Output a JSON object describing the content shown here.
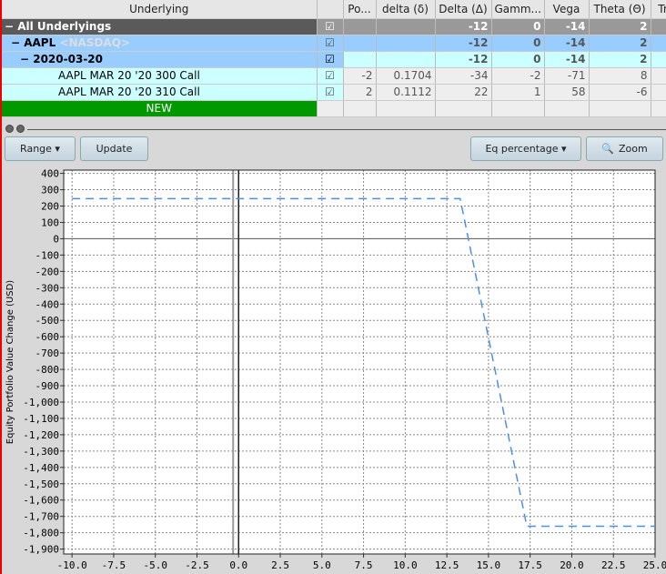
{
  "table": {
    "columns": [
      "Underlying",
      "",
      "Po...",
      "delta (δ)",
      "Delta (Δ)",
      "Gamm...",
      "Vega",
      "Theta (Θ)",
      "Tr"
    ],
    "all": {
      "label": "All Underlyings",
      "values": [
        "",
        "",
        "",
        "-12",
        "0",
        "-14",
        "2"
      ]
    },
    "underlying": {
      "symbol": "AAPL",
      "exchange": "<NASDAQ>",
      "values": [
        "",
        "",
        "",
        "-12",
        "0",
        "-14",
        "2"
      ]
    },
    "expiry": {
      "label": "2020-03-20",
      "values": [
        "",
        "",
        "",
        "-12",
        "0",
        "-14",
        "2"
      ]
    },
    "positions": [
      {
        "label": "AAPL MAR 20 '20 300 Call",
        "values": [
          "",
          "-2",
          "0.1704",
          "-34",
          "-2",
          "-71",
          "8"
        ]
      },
      {
        "label": "AAPL MAR 20 '20 310 Call",
        "values": [
          "",
          "2",
          "0.1112",
          "22",
          "1",
          "58",
          "-6"
        ]
      }
    ],
    "new_label": "NEW",
    "check": "☑"
  },
  "toolbar": {
    "range": "Range ▾",
    "update": "Update",
    "eq": "Eq percentage ▾",
    "zoom": "Zoom"
  },
  "chart_data": {
    "type": "line",
    "ylabel": "Equity Portfolio Value Change (USD)",
    "xlim": [
      -10.5,
      25
    ],
    "ylim": [
      -1930,
      420
    ],
    "xticks": [
      -10,
      -7.5,
      -5,
      -2.5,
      0,
      2.5,
      5,
      7.5,
      10,
      12.5,
      15,
      17.5,
      20,
      22.5,
      25
    ],
    "yticks": [
      400,
      300,
      200,
      100,
      0,
      -100,
      -200,
      -300,
      -400,
      -500,
      -600,
      -700,
      -800,
      -900,
      -1000,
      -1100,
      -1200,
      -1300,
      -1400,
      -1500,
      -1600,
      -1700,
      -1800,
      -1900
    ],
    "grid": true,
    "series": [
      {
        "x": [
          -10,
          13.3,
          17.3,
          25
        ],
        "y": [
          245,
          245,
          -1760,
          -1760
        ],
        "color": "#4a8fe8",
        "style": "dashed"
      }
    ],
    "vline": 0
  }
}
